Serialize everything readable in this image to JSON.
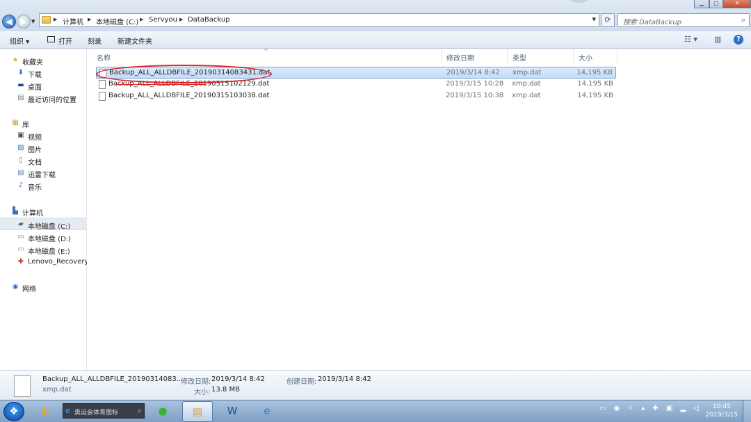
{
  "address": {
    "crumbs": [
      "计算机",
      "本地磁盘 (C:)",
      "Servyou",
      "DataBackup"
    ],
    "search_placeholder": "搜索 DataBackup"
  },
  "toolbar": {
    "organize": "组织 ▾",
    "open": "打开",
    "burn": "刻录",
    "new_folder": "新建文件夹"
  },
  "navpane": {
    "favorites": {
      "label": "收藏夹",
      "items": [
        "下载",
        "桌面",
        "最近访问的位置"
      ]
    },
    "libraries": {
      "label": "库",
      "items": [
        "视频",
        "图片",
        "文档",
        "迅雷下载",
        "音乐"
      ]
    },
    "computer": {
      "label": "计算机",
      "items": [
        "本地磁盘 (C:)",
        "本地磁盘 (D:)",
        "本地磁盘 (E:)",
        "Lenovo_Recovery (F:)"
      ]
    },
    "network": {
      "label": "网络"
    }
  },
  "columns": {
    "name": "名称",
    "modified": "修改日期",
    "type": "类型",
    "size": "大小"
  },
  "files": [
    {
      "name": "Backup_ALL_ALLDBFILE_20190314083431.dat",
      "modified": "2019/3/14 8:42",
      "type": "xmp.dat",
      "size": "14,195 KB"
    },
    {
      "name": "Backup_ALL_ALLDBFILE_20190315102129.dat",
      "modified": "2019/3/15 10:28",
      "type": "xmp.dat",
      "size": "14,195 KB"
    },
    {
      "name": "Backup_ALL_ALLDBFILE_20190315103038.dat",
      "modified": "2019/3/15 10:38",
      "type": "xmp.dat",
      "size": "14,195 KB"
    }
  ],
  "details": {
    "filename": "Backup_ALL_ALLDBFILE_20190314083...",
    "filetype": "xmp.dat",
    "modified_label": "修改日期:",
    "modified_value": "2019/3/14 8:42",
    "size_label": "大小:",
    "size_value": "13.8 MB",
    "created_label": "创建日期:",
    "created_value": "2019/3/14 8:42"
  },
  "taskbar": {
    "search_placeholder": "奥运会体育图标",
    "clock_time": "10:45",
    "clock_date": "2019/3/15"
  },
  "colors": {
    "annotation": "#d8262b",
    "selection": "#cde2fa",
    "taskbar": "#90acd0"
  }
}
